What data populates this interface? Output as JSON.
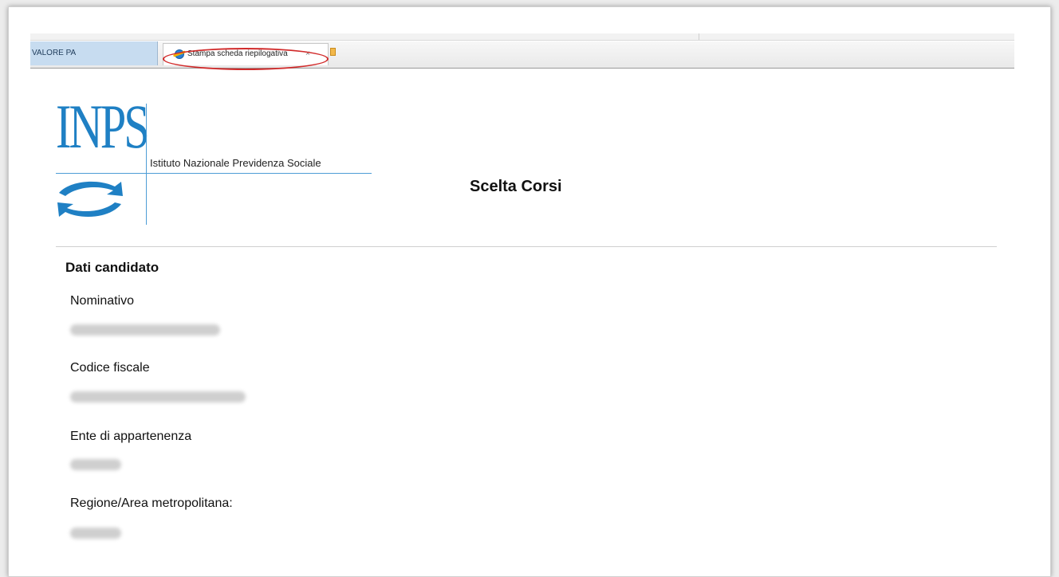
{
  "browser": {
    "favorites_item": "VALORE PA",
    "tab_title": "Stampa scheda riepilogativa",
    "tab_close": "×"
  },
  "header": {
    "logo_text": "INPS",
    "logo_subtitle": "Istituto Nazionale Previdenza Sociale",
    "page_title": "Scelta Corsi",
    "brand_color": "#1f80c4"
  },
  "candidate": {
    "section_title": "Dati candidato",
    "fields": [
      {
        "label": "Nominativo"
      },
      {
        "label": "Codice fiscale"
      },
      {
        "label": "Ente di appartenenza"
      },
      {
        "label": "Regione/Area metropolitana:"
      }
    ]
  },
  "annotation": {
    "highlight_color": "#d12b2b"
  }
}
